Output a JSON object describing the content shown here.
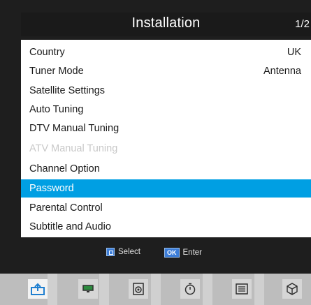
{
  "screen": {
    "title": "Installation",
    "page_indicator": "1/2"
  },
  "menu": {
    "items": [
      {
        "label": "Country",
        "value": "UK",
        "state": "normal"
      },
      {
        "label": "Tuner Mode",
        "value": "Antenna",
        "state": "normal"
      },
      {
        "label": "Satellite Settings",
        "value": "",
        "state": "normal"
      },
      {
        "label": "Auto Tuning",
        "value": "",
        "state": "normal"
      },
      {
        "label": "DTV Manual Tuning",
        "value": "",
        "state": "normal"
      },
      {
        "label": "ATV Manual Tuning",
        "value": "",
        "state": "disabled"
      },
      {
        "label": "Channel Option",
        "value": "",
        "state": "normal"
      },
      {
        "label": "Password",
        "value": "",
        "state": "selected"
      },
      {
        "label": "Parental Control",
        "value": "",
        "state": "normal"
      },
      {
        "label": "Subtitle and Audio",
        "value": "",
        "state": "normal"
      }
    ]
  },
  "hints": {
    "select_label": "Select",
    "ok_key": "OK",
    "enter_label": "Enter"
  },
  "nav": {
    "icons": [
      "installation-icon",
      "tv-icon",
      "speaker-icon",
      "timer-icon",
      "list-icon",
      "cube-icon"
    ],
    "active_index": 0
  },
  "colors": {
    "highlight": "#009fe3",
    "disabled_text": "#c8c8c8",
    "background": "#1e1e1e"
  }
}
